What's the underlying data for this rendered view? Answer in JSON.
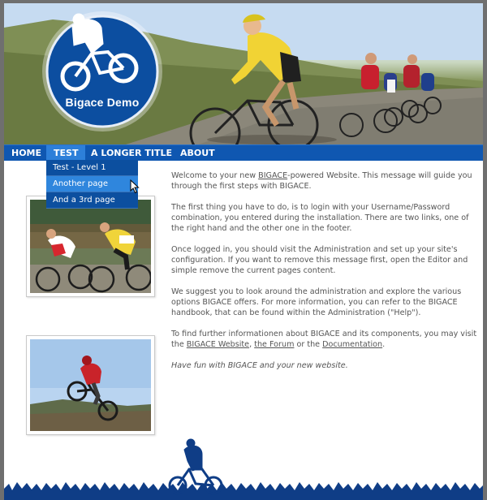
{
  "site": {
    "logo_text": "Bigace Demo"
  },
  "nav": {
    "items": [
      {
        "label": "HOME"
      },
      {
        "label": "TEST"
      },
      {
        "label": "A LONGER TITLE"
      },
      {
        "label": "ABOUT"
      }
    ],
    "active": "TEST",
    "dropdown": [
      {
        "label": "Test - Level 1"
      },
      {
        "label": "Another page"
      },
      {
        "label": "And a 3rd page"
      }
    ]
  },
  "content": {
    "p1_before": "Welcome to your new ",
    "p1_link": "BIGACE",
    "p1_after": "-powered Website. This message will guide you through the first steps with BIGACE.",
    "p2": "The first thing you have to do, is to login with your Username/Password combination, you entered during the installation. There are two links, one of the right hand and the other one in the footer.",
    "p3": "Once logged in, you should visit the Administration and set up your site's configuration. If you want to remove this message first, open the Editor and simple remove the current pages content.",
    "p4": "We suggest you to look around the administration and explore the various options BIGACE offers. For more information, you can refer to the BIGACE handbook, that can be found within the Administration (\"Help\").",
    "p5_before": "To find further informationen about BIGACE and its components, you may visit the ",
    "p5_link1": "BIGACE Website",
    "p5_sep1": ", ",
    "p5_link2": "the Forum",
    "p5_sep2": " or the ",
    "p5_link3": "Documentation",
    "p5_after": ".",
    "p6": "Have fun with BIGACE and your new website."
  }
}
